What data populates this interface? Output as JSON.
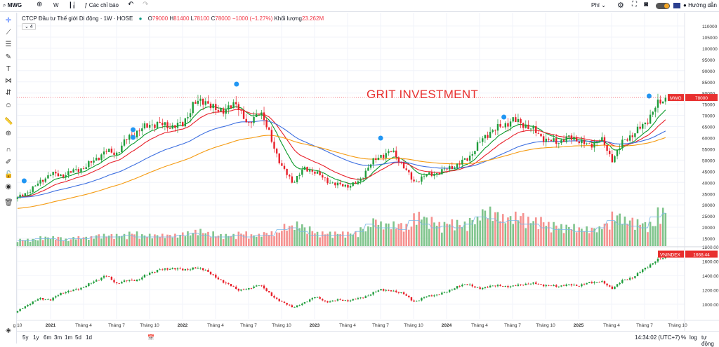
{
  "toolbar": {
    "symbol": "MWG",
    "interval": "W",
    "indicators": "Các chỉ báo",
    "fee": "Phí",
    "guide": "Hướng dẫn"
  },
  "legend": {
    "name": "CTCP Đầu tư Thế giới Di động · 1W · HOSE",
    "o_label": "O",
    "o": "79000",
    "h_label": "H",
    "h": "81400",
    "l_label": "L",
    "l": "78100",
    "c_label": "C",
    "c": "78000",
    "change": "−1000 (−1.27%)",
    "vol_label": "Khối lượng",
    "vol": "23.262M",
    "collapse": "⌄ 4"
  },
  "watermark": "GRIT INVESTMENT",
  "price_axis": [
    "110000",
    "105000",
    "100000",
    "95000",
    "90000",
    "85000",
    "80000",
    "75000",
    "70000",
    "65000",
    "60000",
    "55000",
    "50000",
    "45000",
    "40000",
    "35000",
    "30000",
    "25000",
    "20000",
    "15000"
  ],
  "index_axis": [
    "1800.00",
    "1600.00",
    "1400.00",
    "1200.00",
    "1000.00"
  ],
  "price_tag": {
    "symbol": "MWG",
    "value": "78000"
  },
  "index_tag": {
    "symbol": "VNINDEX",
    "value": "1668.44"
  },
  "time_axis": [
    "g 10",
    "2021",
    "Tháng 4",
    "Tháng 7",
    "Tháng 10",
    "2022",
    "Tháng 4",
    "Tháng 7",
    "Tháng 10",
    "2023",
    "Tháng 4",
    "Tháng 7",
    "Tháng 10",
    "2024",
    "Tháng 4",
    "Tháng 7",
    "Tháng 10",
    "2025",
    "Tháng 4",
    "Tháng 7",
    "Tháng 10"
  ],
  "ranges": [
    "5y",
    "1y",
    "6m",
    "3m",
    "1m",
    "5d",
    "1d"
  ],
  "status": {
    "time": "14:34:02 (UTC+7)",
    "percent": "%",
    "log": "log",
    "auto": "tự động"
  },
  "colors": {
    "up": "#089981",
    "down": "#f23645",
    "ma1": "#0a9a2a",
    "ma2": "#e8202a",
    "ma3": "#3d6fe0",
    "ma4": "#f59b12"
  },
  "chart_data": {
    "type": "candlestick",
    "interval": "weekly",
    "note_units": "VND",
    "months": [
      "2020-10",
      "2020-11",
      "2020-12",
      "2021-01",
      "2021-02",
      "2021-03",
      "2021-04",
      "2021-05",
      "2021-06",
      "2021-07",
      "2021-08",
      "2021-09",
      "2021-10",
      "2021-11",
      "2021-12",
      "2022-01",
      "2022-02",
      "2022-03",
      "2022-04",
      "2022-05",
      "2022-06",
      "2022-07",
      "2022-08",
      "2022-09",
      "2022-10",
      "2022-11",
      "2022-12",
      "2023-01",
      "2023-02",
      "2023-03",
      "2023-04",
      "2023-05",
      "2023-06",
      "2023-07",
      "2023-08",
      "2023-09",
      "2023-10",
      "2023-11",
      "2023-12",
      "2024-01",
      "2024-02",
      "2024-03",
      "2024-04",
      "2024-05",
      "2024-06",
      "2024-07",
      "2024-08",
      "2024-09",
      "2024-10",
      "2024-11",
      "2024-12",
      "2025-01",
      "2025-02",
      "2025-03",
      "2025-04",
      "2025-05",
      "2025-06",
      "2025-07",
      "2025-08",
      "2025-09"
    ],
    "mwg_close": [
      33000,
      36000,
      40000,
      44000,
      43000,
      45000,
      46500,
      50000,
      54000,
      53000,
      60000,
      63000,
      66000,
      66000,
      65000,
      66000,
      75000,
      77000,
      72000,
      73000,
      75000,
      65000,
      73000,
      60000,
      47000,
      40000,
      46000,
      45000,
      41000,
      39000,
      38500,
      40000,
      48000,
      52000,
      54000,
      48000,
      40000,
      43000,
      44000,
      46000,
      48000,
      51000,
      58000,
      63000,
      65000,
      68000,
      66000,
      63000,
      59000,
      58000,
      60000,
      59000,
      56000,
      60000,
      50000,
      58000,
      62000,
      66000,
      74000,
      78000
    ],
    "volume_m": [
      3,
      3,
      4,
      4,
      3,
      4,
      4,
      5,
      5,
      5,
      6,
      5,
      5,
      5,
      5,
      6,
      7,
      6,
      5,
      5,
      6,
      5,
      6,
      6,
      9,
      10,
      8,
      6,
      6,
      6,
      6,
      8,
      12,
      10,
      10,
      9,
      14,
      12,
      10,
      11,
      10,
      12,
      16,
      15,
      13,
      14,
      12,
      12,
      10,
      9,
      9,
      8,
      8,
      10,
      14,
      12,
      11,
      10,
      16,
      18
    ],
    "vnindex_close": [
      900,
      1000,
      1080,
      1060,
      1160,
      1190,
      1240,
      1320,
      1400,
      1290,
      1330,
      1340,
      1440,
      1480,
      1500,
      1480,
      1500,
      1490,
      1370,
      1290,
      1200,
      1210,
      1280,
      1130,
      1030,
      960,
      1010,
      1110,
      1030,
      1060,
      1050,
      1080,
      1130,
      1210,
      1180,
      1160,
      1030,
      1100,
      1130,
      1170,
      1250,
      1280,
      1210,
      1260,
      1250,
      1250,
      1280,
      1290,
      1260,
      1250,
      1270,
      1260,
      1300,
      1320,
      1220,
      1330,
      1380,
      1500,
      1600,
      1668.44
    ],
    "price_range": [
      15000,
      110000
    ],
    "index_range": [
      800,
      1800
    ]
  }
}
